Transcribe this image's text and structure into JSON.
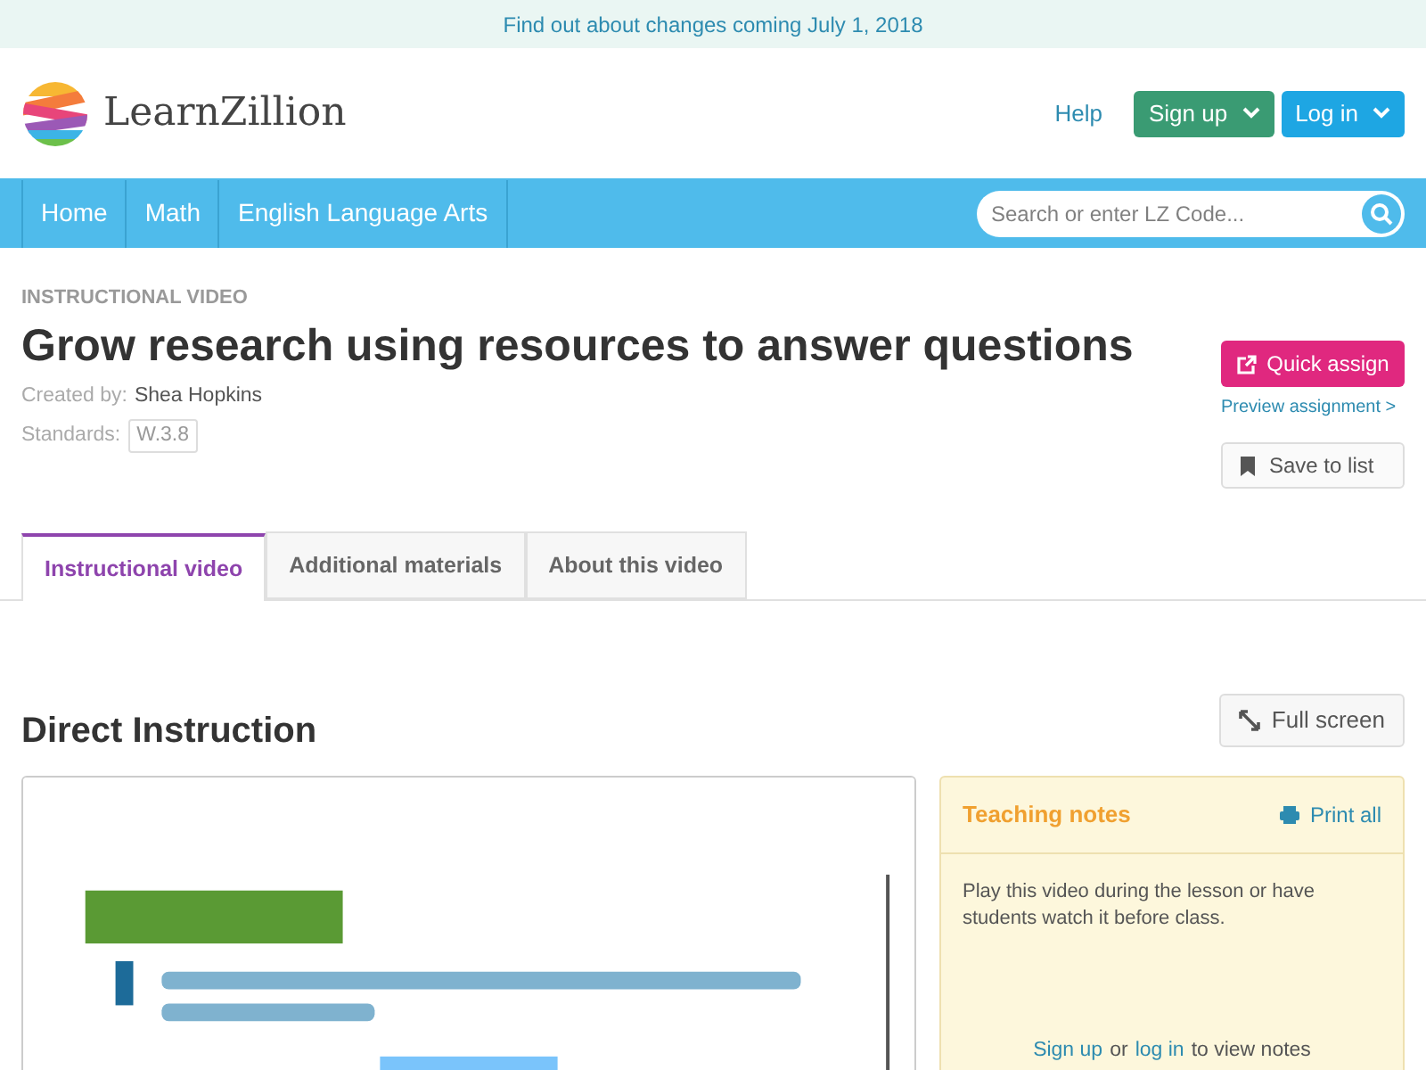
{
  "announcement": "Find out about changes coming July 1, 2018",
  "header": {
    "logo_text": "LearnZillion",
    "help_link": "Help",
    "buttons": [
      {
        "label": "Sign up",
        "kind": "green"
      },
      {
        "label": "Log in",
        "kind": "blue"
      }
    ]
  },
  "nav": {
    "items": [
      {
        "label": "Home"
      },
      {
        "label": "Math"
      },
      {
        "label": "English Language Arts"
      }
    ],
    "search": {
      "placeholder": "Search or enter LZ Code..."
    }
  },
  "lesson": {
    "category": "INSTRUCTIONAL VIDEO",
    "title": "Grow research using resources to answer questions",
    "created_by_label": "Created by:",
    "author": "Shea Hopkins",
    "standards_label": "Standards:",
    "standard": "W.3.8",
    "quick_assign": "Quick assign",
    "preview_link": "Preview assignment >",
    "save_button": "Save to list"
  },
  "tabs": [
    {
      "label": "Instructional video",
      "selected": true
    },
    {
      "label": "Additional materials",
      "selected": false
    },
    {
      "label": "About this video",
      "selected": false
    }
  ],
  "section": {
    "title": "Direct Instruction",
    "fullscreen_button": "Full screen"
  },
  "notes": {
    "title": "Teaching notes",
    "print_link": "Print all",
    "body": "Play this video during the lesson or have students watch it before class.",
    "signup_link": "Sign up",
    "or_text": "or",
    "login_link": "log in",
    "tail_text": "to view notes"
  }
}
